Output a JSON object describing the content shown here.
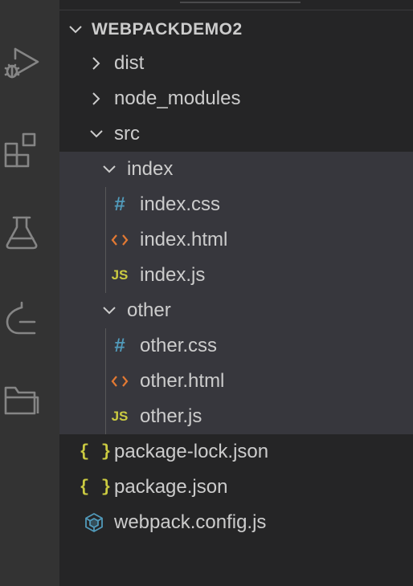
{
  "activity_bar": {
    "icons": [
      "run-debug-icon",
      "extensions-icon",
      "testing-flask-icon",
      "git-graph-icon",
      "folder-icon"
    ]
  },
  "explorer": {
    "workspace": "WEBPACKDEMO2",
    "items": [
      {
        "label": "dist",
        "kind": "folder",
        "expanded": false
      },
      {
        "label": "node_modules",
        "kind": "folder",
        "expanded": false
      },
      {
        "label": "src",
        "kind": "folder",
        "expanded": true
      },
      {
        "label": "index",
        "kind": "folder",
        "expanded": true
      },
      {
        "label": "index.css",
        "kind": "file",
        "icon": "css-hash-icon"
      },
      {
        "label": "index.html",
        "kind": "file",
        "icon": "html-brackets-icon"
      },
      {
        "label": "index.js",
        "kind": "file",
        "icon": "js-icon"
      },
      {
        "label": "other",
        "kind": "folder",
        "expanded": true
      },
      {
        "label": "other.css",
        "kind": "file",
        "icon": "css-hash-icon"
      },
      {
        "label": "other.html",
        "kind": "file",
        "icon": "html-brackets-icon"
      },
      {
        "label": "other.js",
        "kind": "file",
        "icon": "js-icon"
      },
      {
        "label": "package-lock.json",
        "kind": "file",
        "icon": "json-braces-icon"
      },
      {
        "label": "package.json",
        "kind": "file",
        "icon": "json-braces-icon"
      },
      {
        "label": "webpack.config.js",
        "kind": "file",
        "icon": "webpack-cube-icon"
      }
    ],
    "icon_text": {
      "css": "#",
      "js": "JS",
      "json": "{ }"
    }
  },
  "colors": {
    "activity_bar_bg": "#333333",
    "sidebar_bg": "#252526",
    "selected_bg": "#37373d",
    "text": "#cccccc",
    "css_icon": "#519aba",
    "html_icon": "#e37933",
    "js_icon": "#cbcb41",
    "webpack_icon": "#519aba"
  }
}
